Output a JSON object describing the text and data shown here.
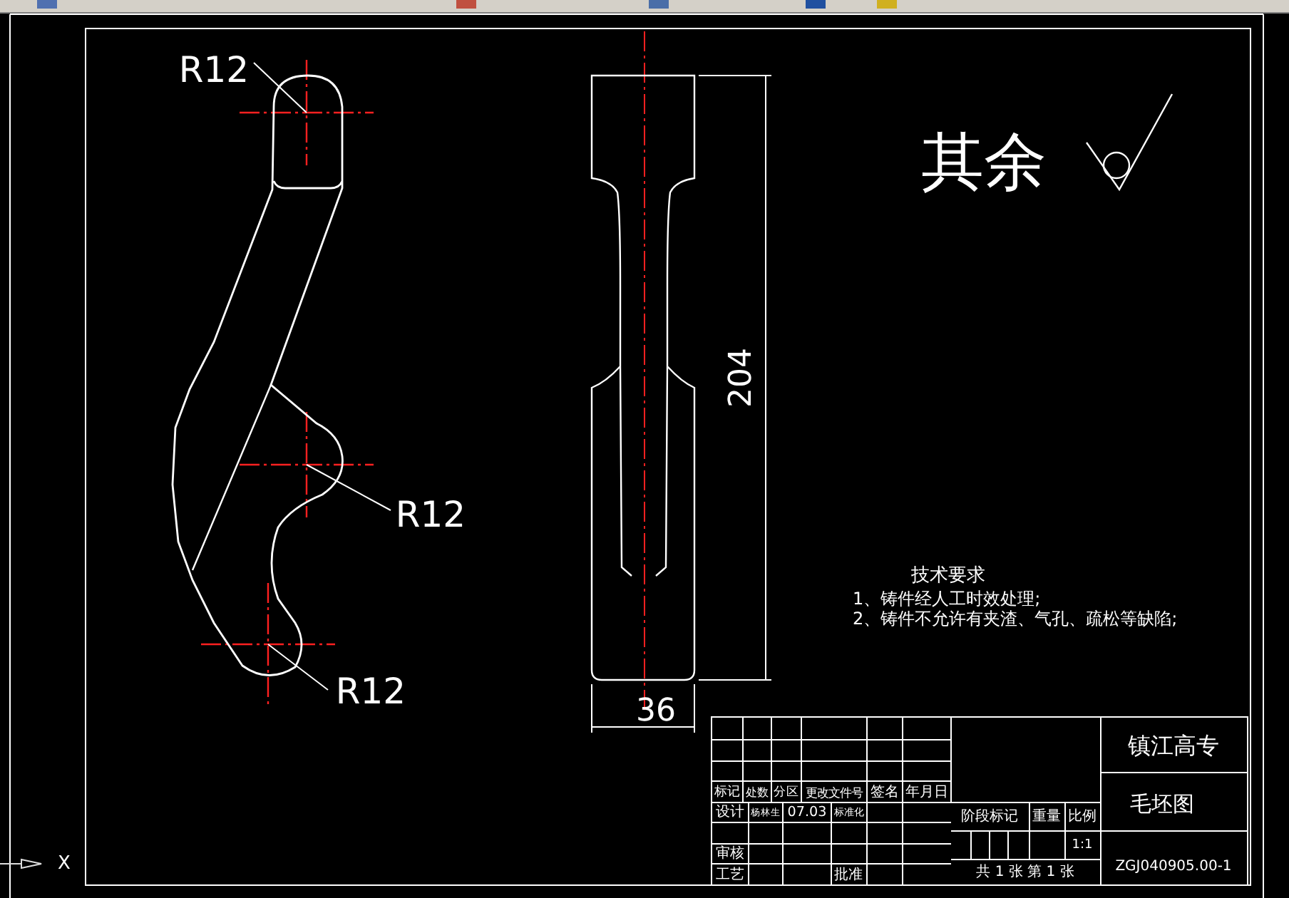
{
  "drawing": {
    "radius_labels": [
      "R12",
      "R12",
      "R12"
    ],
    "length_dimension": "204",
    "width_dimension": "36",
    "surface_note": "其余",
    "requirements": {
      "title": "技术要求",
      "items": [
        "1、铸件经人工时效处理;",
        "2、铸件不允许有夹渣、气孔、疏松等缺陷;"
      ]
    }
  },
  "title_block": {
    "revision_header": [
      "标记",
      "处数",
      "分区",
      "更改文件号",
      "签名",
      "年月日"
    ],
    "design_row": [
      "设计",
      "杨林生",
      "07.03",
      "标准化"
    ],
    "review_label": "审核",
    "process_label": "工艺",
    "approve_label": "批准",
    "stage_label": "阶段标记",
    "weight_label": "重量",
    "scale_label": "比例",
    "scale": "1:1",
    "sheets": "共 1 张 第 1 张",
    "school": "镇江高专",
    "drawing_name": "毛坯图",
    "drawing_number": "ZGJ040905.00-1"
  },
  "ucs_axis_label": "X"
}
